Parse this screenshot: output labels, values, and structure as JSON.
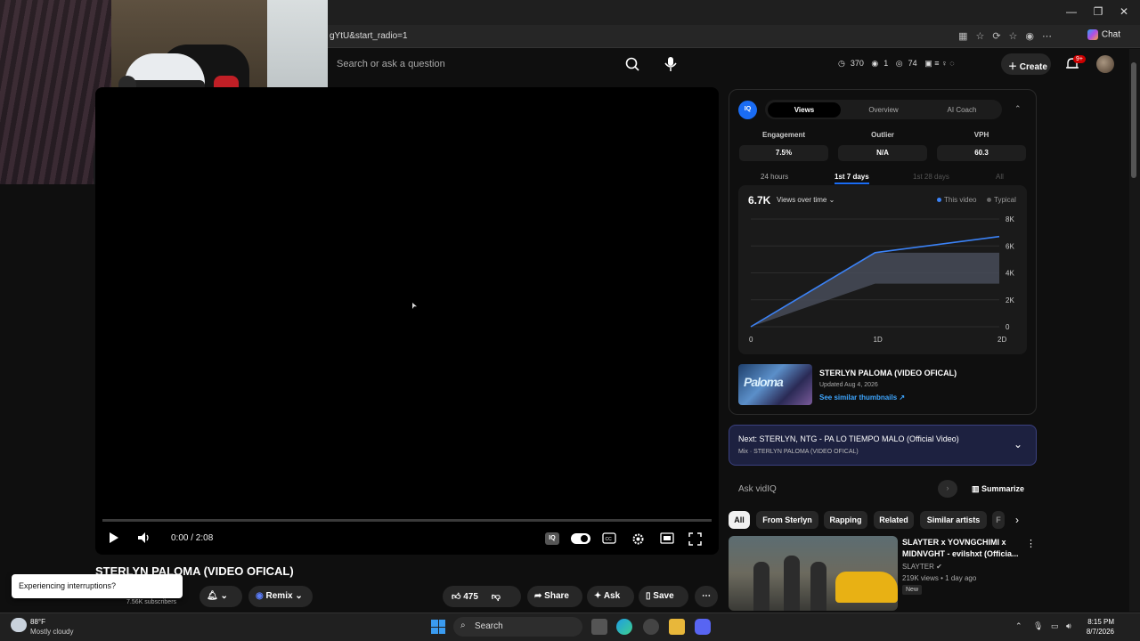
{
  "browser": {
    "url": "gYtU&start_radio=1",
    "chat_label": "Chat",
    "window_controls": [
      "minimize-icon",
      "restore-icon",
      "close-icon"
    ]
  },
  "header": {
    "search_placeholder": "Search or ask a question",
    "stats": {
      "stat1": "370",
      "stat2": "1",
      "stat3": "74"
    },
    "create_label": "Create",
    "notif_badge": "9+"
  },
  "player": {
    "time": "0:00 / 2:08",
    "iq_chip": "IQ"
  },
  "video": {
    "title": "STERLYN PALOMA (VIDEO OFICAL)",
    "subscribers": "7.56K subscribers",
    "toast": "Experiencing interruptions?",
    "remix_label": "Remix",
    "likes": "475",
    "share_label": "Share",
    "ask_label": "Ask",
    "save_label": "Save"
  },
  "vidiq": {
    "logo": "IQ",
    "tabs": [
      "Views",
      "Overview",
      "AI Coach"
    ],
    "metrics": [
      {
        "label": "Engagement",
        "value": "7.5%"
      },
      {
        "label": "Outlier",
        "value": "N/A"
      },
      {
        "label": "VPH",
        "value": "60.3"
      }
    ],
    "ranges": [
      "24 hours",
      "1st 7 days",
      "1st 28 days",
      "All"
    ],
    "total": "6.7K",
    "chart_selector": "Views over time",
    "legend_this": "This video",
    "legend_typical": "Typical",
    "card": {
      "thumb_text": "Paloma",
      "title": "STERLYN PALOMA (VIDEO OFICAL)",
      "updated": "Updated Aug 4, 2026",
      "link": "See similar thumbnails ↗"
    }
  },
  "chart_data": {
    "type": "line",
    "x": [
      "0",
      "1D",
      "2D"
    ],
    "xlabel": "",
    "ylabel": "",
    "yticks": [
      "0",
      "2K",
      "4K",
      "6K",
      "8K"
    ],
    "ylim": [
      0,
      8000
    ],
    "series": [
      {
        "name": "This video",
        "x": [
          0,
          1,
          2
        ],
        "values": [
          0,
          5500,
          6700
        ],
        "color": "#3b82f6"
      },
      {
        "name": "Typical",
        "x": [
          0,
          1,
          2
        ],
        "values_low": [
          0,
          3200,
          3200
        ],
        "values_high": [
          0,
          5500,
          5500
        ],
        "color": "#4a4f5c"
      }
    ],
    "legend": "top-right",
    "grid": true
  },
  "next": {
    "title": "Next: STERLYN, NTG - PA LO TIEMPO MALO (Official Video)",
    "sub": "Mix · STERLYN PALOMA (VIDEO OFICAL)"
  },
  "ask": {
    "placeholder": "Ask vidIQ",
    "summarize": "Summarize"
  },
  "chips": [
    "All",
    "From Sterlyn",
    "Rapping",
    "Related",
    "Similar artists",
    "F"
  ],
  "recommended": {
    "title": "SLAYTER x YOVNGCHIMI x MIDNVGHT - evilshxt (Officia...",
    "channel": "SLAYTER",
    "meta": "219K views • 1 day ago",
    "badge": "New"
  },
  "taskbar": {
    "temp": "88°F",
    "condition": "Mostly cloudy",
    "search": "Search",
    "time": "8:15 PM",
    "date": "8/7/2026"
  },
  "colors": {
    "accent": "#1a6cf4",
    "link": "#3ea6ff",
    "series_this": "#3b82f6"
  }
}
